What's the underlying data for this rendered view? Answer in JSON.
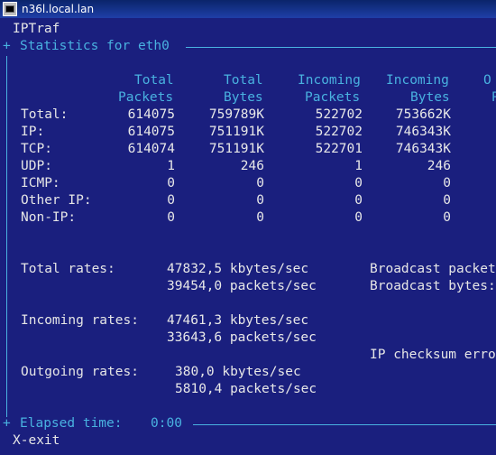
{
  "window": {
    "title": "n36l.local.lan"
  },
  "app": {
    "name": "IPTraf",
    "exit_hint": "X-exit"
  },
  "panel": {
    "title": "Statistics for eth0"
  },
  "columns": {
    "line1": [
      "Total",
      "Total",
      "Incoming",
      "Incoming",
      "O"
    ],
    "line2": [
      "Packets",
      "Bytes",
      "Packets",
      "Bytes",
      "P"
    ]
  },
  "rows": [
    {
      "label": "Total:",
      "values": [
        "614075",
        "759789K",
        "522702",
        "753662K"
      ]
    },
    {
      "label": "IP:",
      "values": [
        "614075",
        "751191K",
        "522702",
        "746343K"
      ]
    },
    {
      "label": "TCP:",
      "values": [
        "614074",
        "751191K",
        "522701",
        "746343K"
      ]
    },
    {
      "label": "UDP:",
      "values": [
        "1",
        "246",
        "1",
        "246"
      ]
    },
    {
      "label": "ICMP:",
      "values": [
        "0",
        "0",
        "0",
        "0"
      ]
    },
    {
      "label": "Other IP:",
      "values": [
        "0",
        "0",
        "0",
        "0"
      ]
    },
    {
      "label": "Non-IP:",
      "values": [
        "0",
        "0",
        "0",
        "0"
      ]
    }
  ],
  "rates": {
    "total_label": "Total rates:",
    "total_kbytes": "47832,5 kbytes/sec",
    "total_packets": "39454,0 packets/sec",
    "incoming_label": "Incoming rates:",
    "incoming_kbytes": "47461,3 kbytes/sec",
    "incoming_packets": "33643,6 packets/sec",
    "outgoing_label": "Outgoing rates:",
    "outgoing_kbytes": "380,0 kbytes/sec",
    "outgoing_packets": "5810,4 packets/sec"
  },
  "side": {
    "broadcast_packets": "Broadcast packet",
    "broadcast_bytes": "Broadcast bytes:",
    "checksum": "IP checksum erro"
  },
  "footer": {
    "elapsed_label": "Elapsed time:",
    "elapsed_value": "0:00"
  }
}
